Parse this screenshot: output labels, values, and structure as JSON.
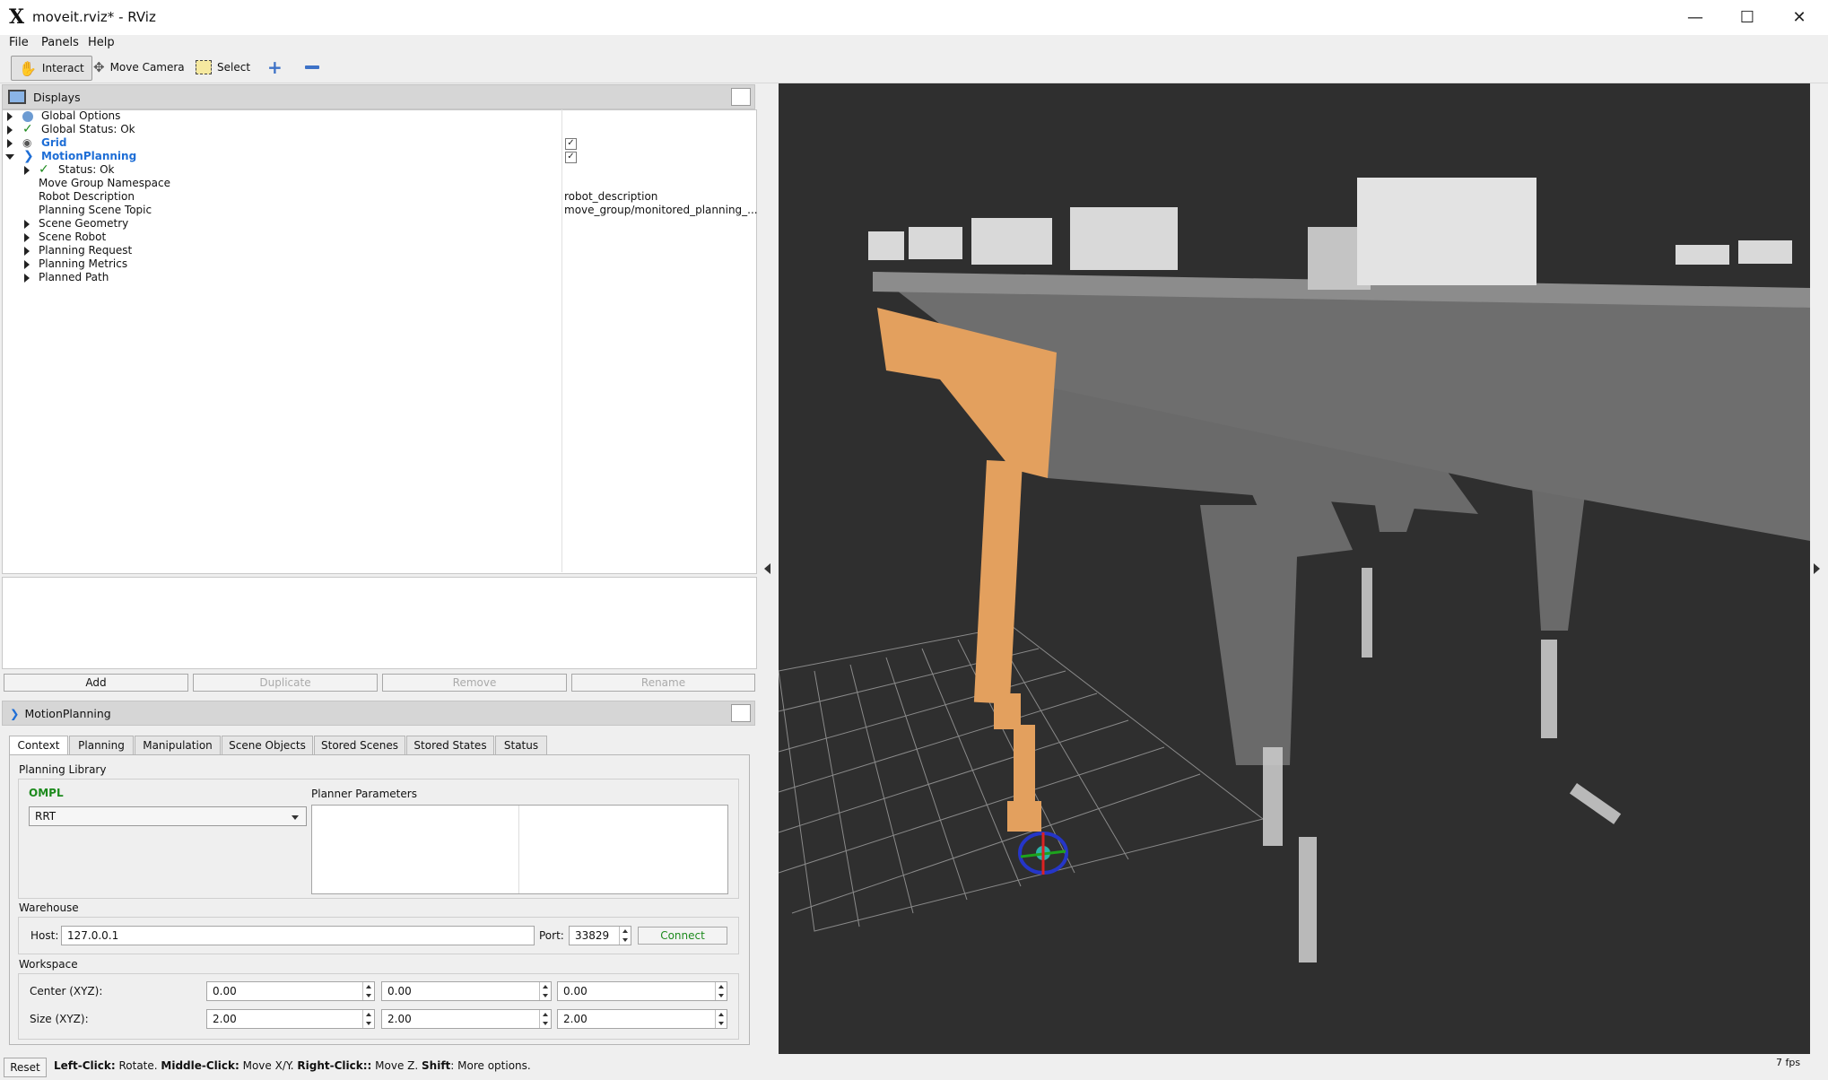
{
  "window": {
    "title": "moveit.rviz* - RViz",
    "logo": "X"
  },
  "menu": [
    "File",
    "Panels",
    "Help"
  ],
  "toolbar": {
    "interact": "Interact",
    "move_camera": "Move Camera",
    "select": "Select"
  },
  "displays": {
    "title": "Displays",
    "tree": [
      {
        "label": "Global Options",
        "value": ""
      },
      {
        "label": "Global Status: Ok",
        "value": ""
      },
      {
        "label": "Grid",
        "value": ""
      },
      {
        "label": "MotionPlanning",
        "value": ""
      },
      {
        "label": "Status: Ok",
        "value": ""
      },
      {
        "label": "Move Group Namespace",
        "value": ""
      },
      {
        "label": "Robot Description",
        "value": "robot_description"
      },
      {
        "label": "Planning Scene Topic",
        "value": "move_group/monitored_planning_..."
      },
      {
        "label": "Scene Geometry",
        "value": ""
      },
      {
        "label": "Scene Robot",
        "value": ""
      },
      {
        "label": "Planning Request",
        "value": ""
      },
      {
        "label": "Planning Metrics",
        "value": ""
      },
      {
        "label": "Planned Path",
        "value": ""
      }
    ],
    "buttons": {
      "add": "Add",
      "duplicate": "Duplicate",
      "remove": "Remove",
      "rename": "Rename"
    }
  },
  "motion_planning": {
    "title": "MotionPlanning",
    "tabs": [
      "Context",
      "Planning",
      "Manipulation",
      "Scene Objects",
      "Stored Scenes",
      "Stored States",
      "Status"
    ],
    "planning_library": {
      "label": "Planning Library",
      "library": "OMPL",
      "planner": "RRT",
      "params_label": "Planner Parameters"
    },
    "warehouse": {
      "label": "Warehouse",
      "host_label": "Host:",
      "host": "127.0.0.1",
      "port_label": "Port:",
      "port": "33829",
      "connect": "Connect"
    },
    "workspace": {
      "label": "Workspace",
      "center_label": "Center (XYZ):",
      "center": [
        "0.00",
        "0.00",
        "0.00"
      ],
      "size_label": "Size (XYZ):",
      "size": [
        "2.00",
        "2.00",
        "2.00"
      ]
    }
  },
  "status_bar": {
    "reset": "Reset",
    "hints": [
      {
        "key": "Left-Click:",
        "text": " Rotate. "
      },
      {
        "key": "Middle-Click:",
        "text": " Move X/Y. "
      },
      {
        "key": "Right-Click::",
        "text": " Move Z. "
      },
      {
        "key": "Shift",
        "text": ": More options."
      }
    ],
    "fps": "7 fps"
  },
  "colors": {
    "accent_blue": "#1e6ed6",
    "ompl_green": "#1d8a1d",
    "robot_orange": "#e3a05e",
    "viewport_bg": "#2f2f2f"
  }
}
